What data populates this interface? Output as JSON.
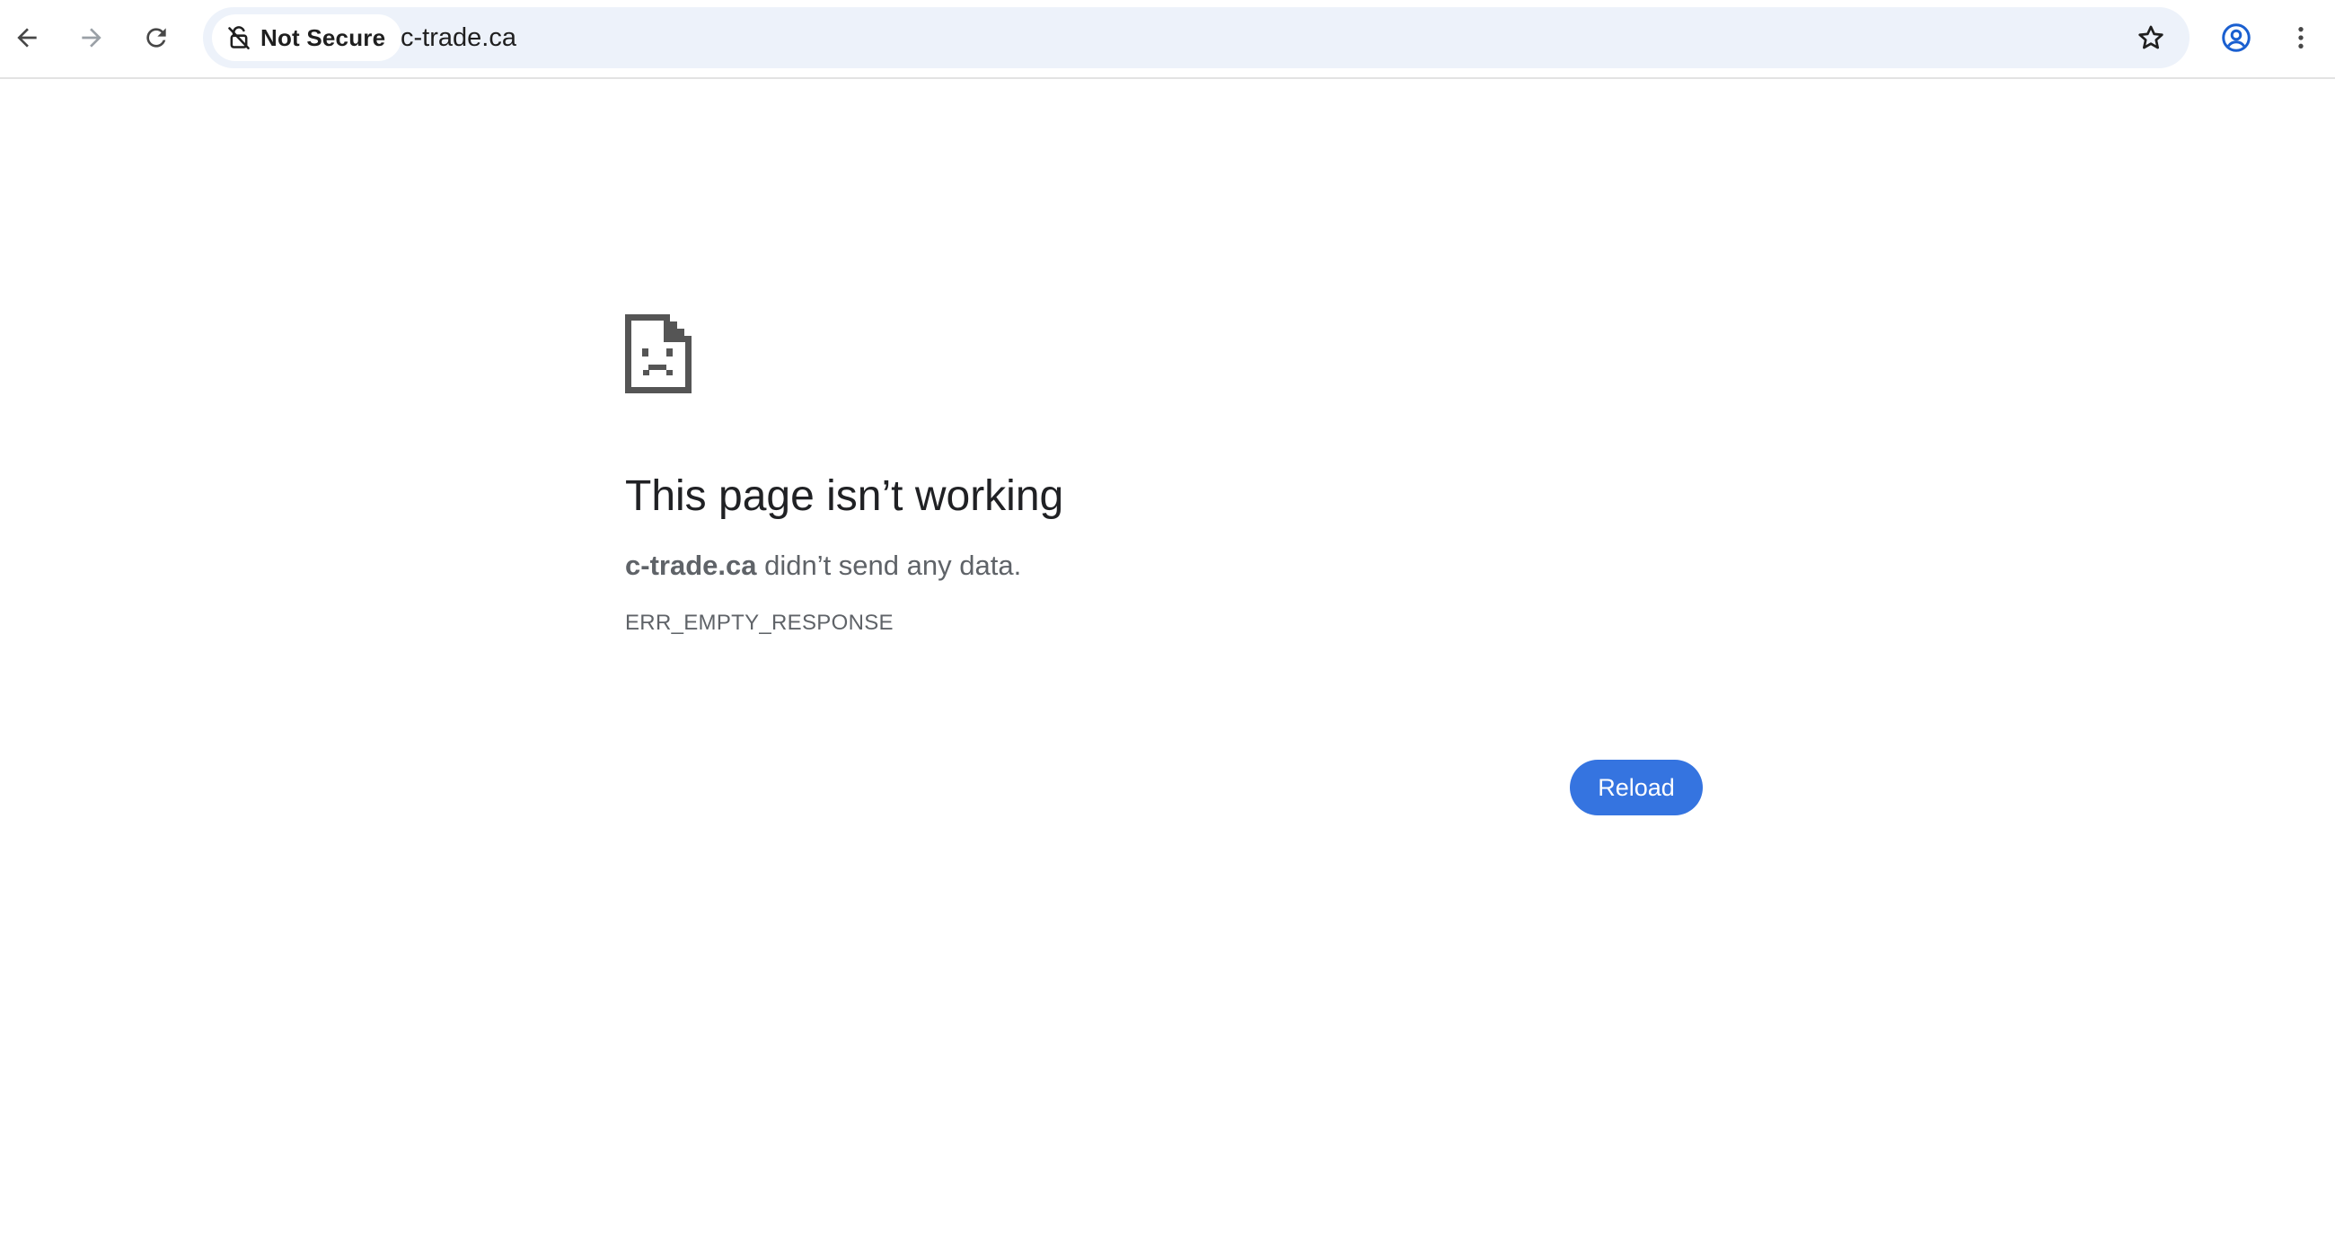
{
  "browser": {
    "security_chip": "Not Secure",
    "url": "c-trade.ca",
    "icons": {
      "back": "arrow-left-icon",
      "forward": "arrow-right-icon",
      "reload": "refresh-icon",
      "not_secure": "broken-lock-icon",
      "bookmark": "star-icon",
      "profile": "account-circle-icon",
      "menu": "kebab-menu-icon"
    },
    "forward_disabled": true
  },
  "error_page": {
    "icon": "sad-page-icon",
    "heading": "This page isn’t working",
    "host": "c-trade.ca",
    "message_suffix": " didn’t send any data.",
    "error_code": "ERR_EMPTY_RESPONSE",
    "reload_label": "Reload"
  },
  "colors": {
    "accent": "#3574e0",
    "omnibox_bg": "#edf2fa",
    "profile_icon": "#1a5fd0",
    "text_primary": "#202124",
    "text_secondary": "#5f6368"
  }
}
